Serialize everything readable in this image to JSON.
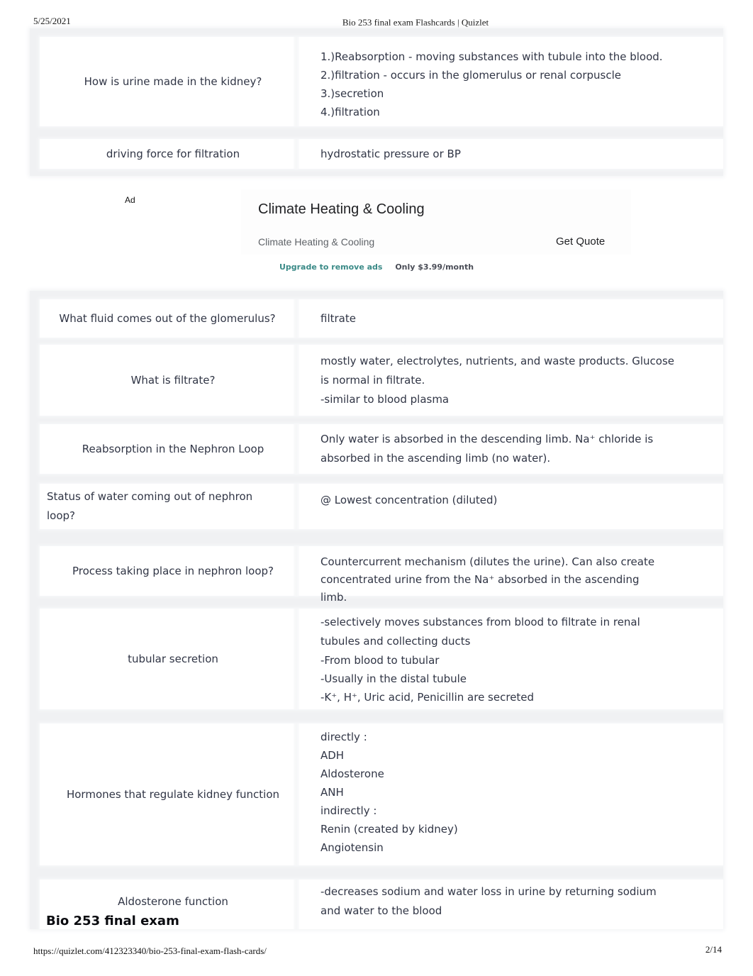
{
  "print_header": {
    "date": "5/25/2021",
    "title": "Bio 253 final exam Flashcards | Quizlet"
  },
  "print_footer": {
    "url": "https://quizlet.com/412323340/bio-253-final-exam-flash-cards/",
    "page": "2/14"
  },
  "cards_group_1": [
    {
      "term": "How is urine made in the kidney?",
      "definition": [
        "1.)Reabsorption - moving substances with tubule into the blood.",
        "2.)filtration - occurs in the glomerulus or renal corpuscle",
        "3.)secretion",
        "4.)filtration"
      ]
    },
    {
      "term": "driving force for filtration",
      "definition": [
        "hydrostatic pressure or BP"
      ]
    }
  ],
  "ad": {
    "label": "Ad",
    "headline": "Climate Heating & Cooling",
    "subtext": "Climate Heating & Cooling",
    "cta": "Get Quote",
    "upgrade_link": "Upgrade to remove ads",
    "upgrade_price": "Only $3.99/month",
    "accent_color": "#3a8a87"
  },
  "cards_group_2": [
    {
      "term": "What fluid comes out of the glomerulus?",
      "definition": [
        "filtrate"
      ]
    },
    {
      "term": "What is filtrate?",
      "definition": [
        "mostly water, electrolytes, nutrients, and waste products. Glucose is normal in filtrate.",
        "-similar to blood plasma"
      ]
    },
    {
      "term": "Reabsorption in the Nephron Loop",
      "definition": [
        "Only water is absorbed in the descending limb. Na⁺ chloride is absorbed in the ascending limb (no water)."
      ]
    },
    {
      "term": "Status of water coming out of nephron loop?",
      "definition": [
        "@ Lowest concentration (diluted)"
      ]
    },
    {
      "term": "Process taking place in nephron loop?",
      "definition": [
        "Countercurrent mechanism (dilutes the urine). Can also create concentrated urine from the Na⁺ absorbed in the ascending limb."
      ]
    },
    {
      "term": "tubular secretion",
      "definition": [
        "-selectively moves substances from blood to filtrate in renal tubules and collecting ducts",
        "-From blood to tubular",
        "-Usually in the distal tubule",
        "-K⁺, H⁺, Uric acid, Penicillin are secreted"
      ]
    },
    {
      "term": "Hormones that regulate kidney function",
      "definition": [
        "directly :",
        "ADH",
        "Aldosterone",
        "ANH",
        "indirectly :",
        "Renin (created by kidney)",
        "Angiotensin"
      ]
    },
    {
      "term": "Aldosterone function",
      "definition": [
        "-decreases sodium and water loss in urine by returning sodium and water to the blood"
      ]
    }
  ],
  "set_title": "Bio 253 final exam"
}
